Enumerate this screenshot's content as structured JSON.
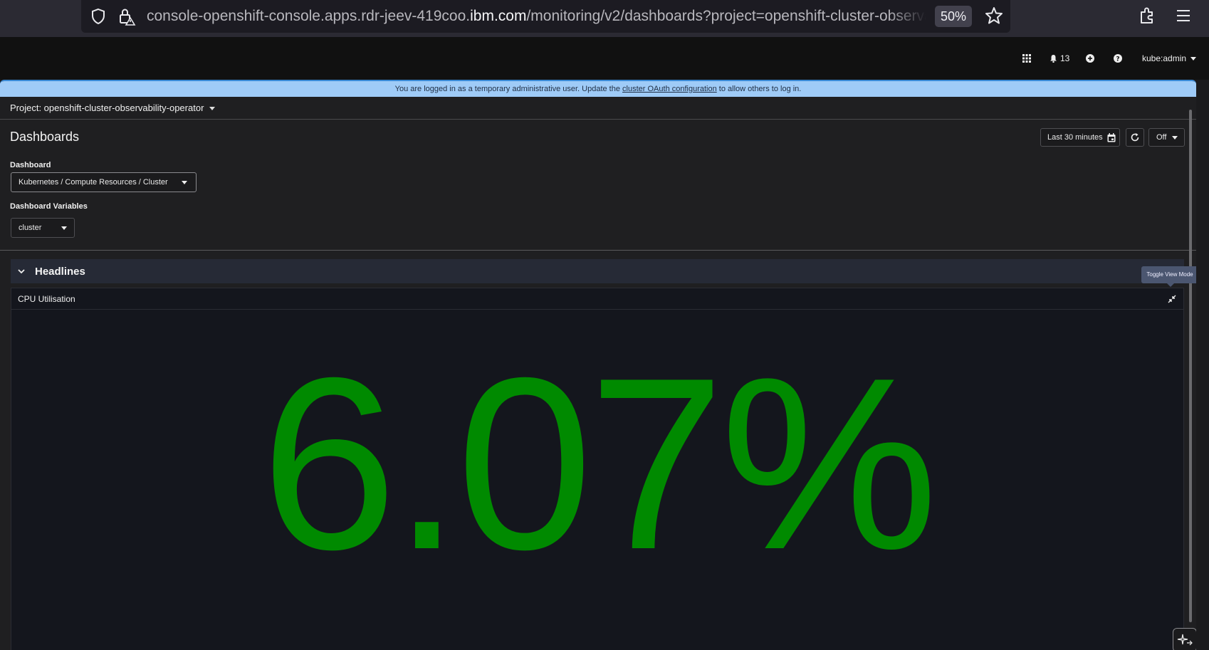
{
  "browser": {
    "url_prefix": "console-openshift-console.apps.rdr-jeev-419coo.",
    "url_host": "ibm.com",
    "url_suffix": "/monitoring/v2/dashboards?project=openshift-cluster-observa",
    "zoom": "50%"
  },
  "masthead": {
    "notifications_count": "13",
    "user": "kube:admin"
  },
  "banner": {
    "text_before": "You are logged in as a temporary administrative user. Update the ",
    "link": "cluster OAuth configuration",
    "text_after": " to allow others to log in."
  },
  "project": {
    "label": "Project: openshift-cluster-observability-operator"
  },
  "page": {
    "title": "Dashboards"
  },
  "toolbar": {
    "time_range": "Last 30 minutes",
    "refresh_interval": "Off"
  },
  "dashboard": {
    "label": "Dashboard",
    "selected": "Kubernetes / Compute Resources / Cluster"
  },
  "variables": {
    "label": "Dashboard Variables",
    "cluster": "cluster"
  },
  "section": {
    "title": "Headlines",
    "tooltip": "Toggle View Mode"
  },
  "panel": {
    "title": "CPU Utilisation",
    "value": "6.07%",
    "value_color": "#008a00"
  },
  "colors": {
    "accent": "#3a8ad6",
    "banner": "#9fcbf7"
  }
}
